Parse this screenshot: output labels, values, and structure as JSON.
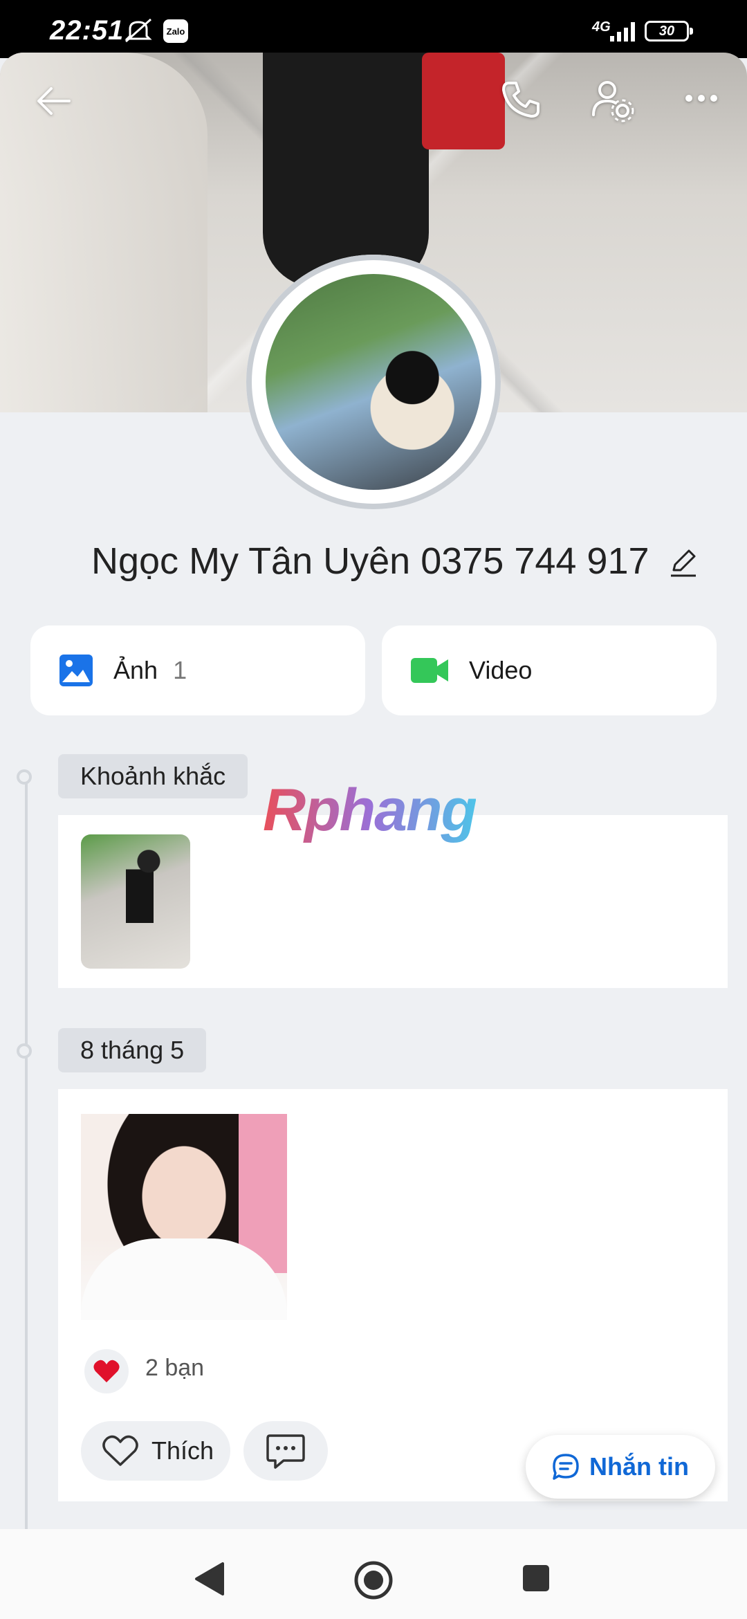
{
  "status_bar": {
    "time": "22:51",
    "network": "4G",
    "battery": "30",
    "app_badge": "Zalo"
  },
  "profile": {
    "name": "Ngọc My Tân Uyên 0375 744 917"
  },
  "media_tabs": {
    "photos_label": "Ảnh",
    "photos_count": "1",
    "video_label": "Video"
  },
  "watermark": "Rphang",
  "timeline": [
    {
      "label": "Khoảnh khắc"
    },
    {
      "label": "8 tháng 5"
    }
  ],
  "post": {
    "reaction_count": "2 bạn",
    "like_label": "Thích"
  },
  "fab": {
    "label": "Nhắn tin"
  },
  "colors": {
    "accent": "#1068d6",
    "video_green": "#34c759",
    "photo_blue": "#1a73e8",
    "heart_red": "#e0112b"
  }
}
